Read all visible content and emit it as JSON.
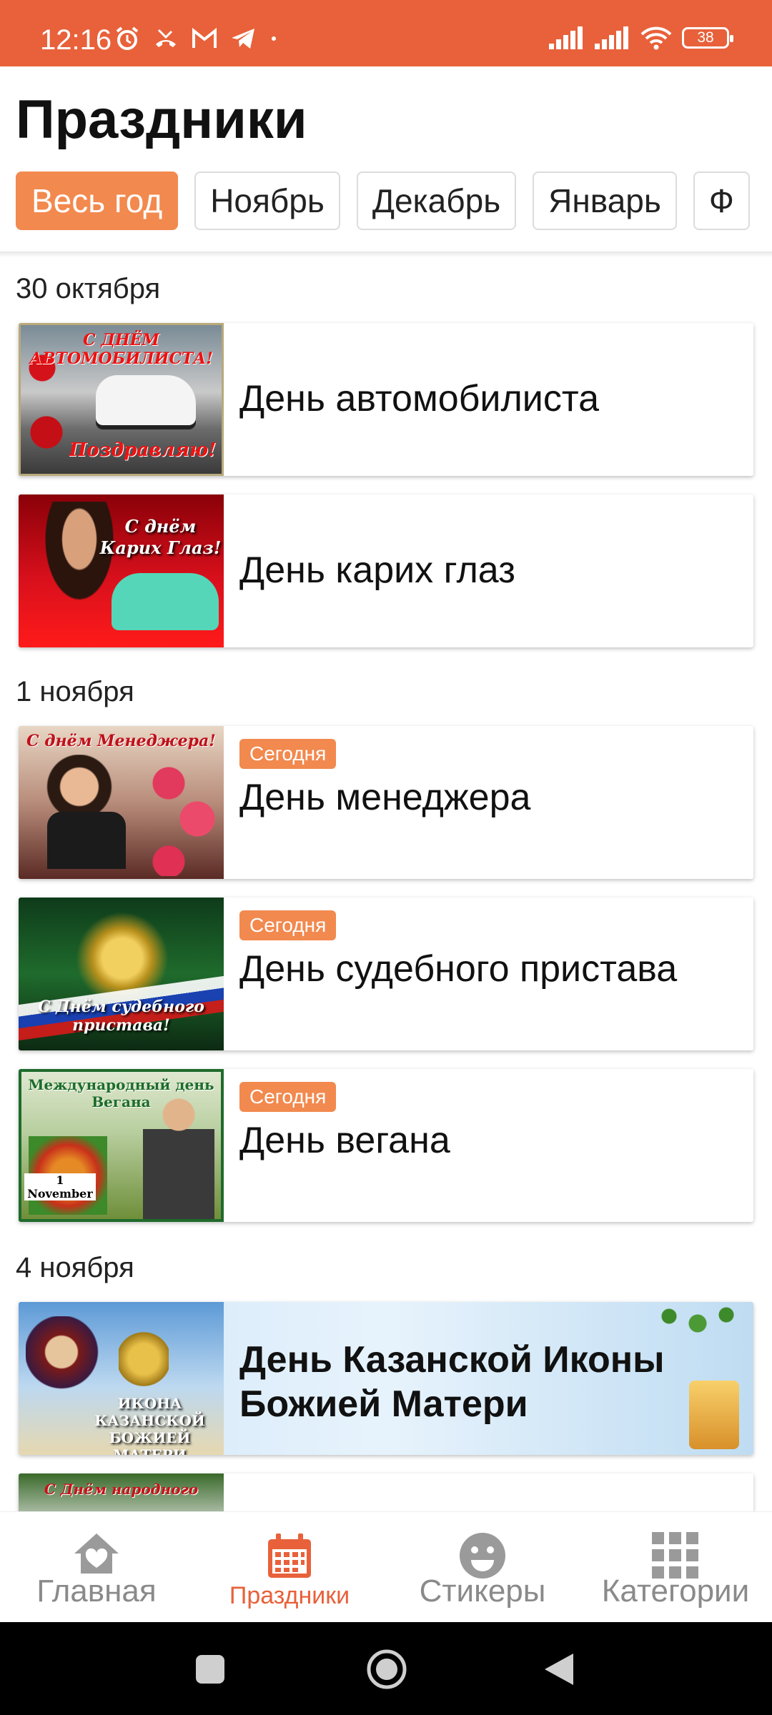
{
  "status_bar": {
    "time": "12:16",
    "battery": "38",
    "icons": [
      "alarm-icon",
      "missed-call-icon",
      "gmail-icon",
      "telegram-icon",
      "dot-icon",
      "signal-icon",
      "signal-icon",
      "wifi-icon",
      "battery-icon"
    ]
  },
  "header": {
    "title": "Праздники",
    "tabs": [
      "Весь год",
      "Ноябрь",
      "Декабрь",
      "Январь",
      "Ф"
    ],
    "active_tab": "Весь год"
  },
  "sections": [
    {
      "date": "30 октября",
      "items": [
        {
          "title": "День автомобилиста",
          "image_text": "С ДНЁМ АВТОМОБИЛИСТА!",
          "image_text2": "Поздравляю!"
        },
        {
          "title": "День карих глаз",
          "image_text": "С днём Карих Глаз!"
        }
      ]
    },
    {
      "date": "1 ноября",
      "items": [
        {
          "title": "День менеджера",
          "badge": "Сегодня",
          "image_text": "С днём Менеджера!"
        },
        {
          "title": "День судебного пристава",
          "badge": "Сегодня",
          "image_text": "С Днём судебного пристава!"
        },
        {
          "title": "День вегана",
          "badge": "Сегодня",
          "image_text": "Международный день Вегана",
          "image_text2": "1 November"
        }
      ]
    },
    {
      "date": "4 ноября",
      "items": [
        {
          "title": "День Казанской Иконы Божией Матери",
          "image_text": "ИКОНА КАЗАНСКОЙ БОЖИЕЙ МАТЕРИ"
        },
        {
          "title": "",
          "image_text": "С Днём народного"
        }
      ]
    }
  ],
  "bottom_nav": [
    {
      "label": "Главная",
      "icon": "home-heart-icon"
    },
    {
      "label": "Праздники",
      "icon": "calendar-icon",
      "active": true
    },
    {
      "label": "Стикеры",
      "icon": "smiley-icon"
    },
    {
      "label": "Категории",
      "icon": "grid-icon"
    }
  ],
  "colors": {
    "accent": "#E8613A",
    "chip_active": "#F2894E",
    "badge": "#F2894E"
  }
}
